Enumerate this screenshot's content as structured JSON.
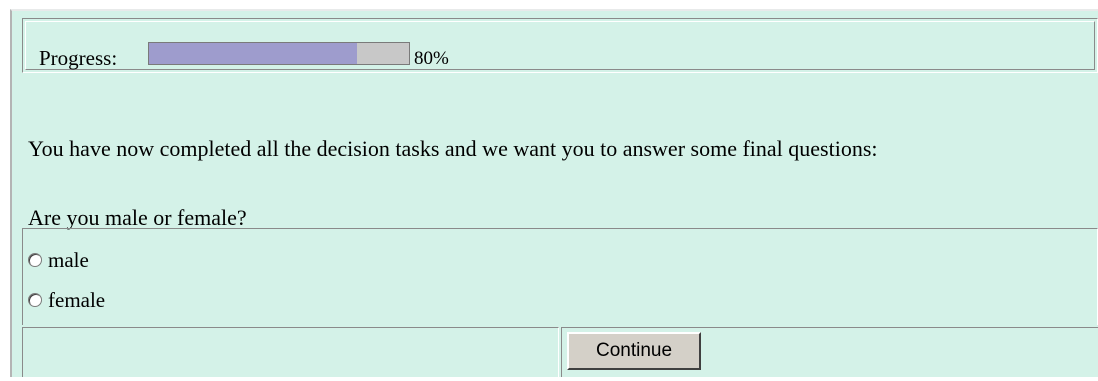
{
  "progress": {
    "label": "Progress:",
    "fraction": 0.8,
    "value_text": "80%",
    "fill_color": "#9e9ccd",
    "track_color": "#c8c8c8"
  },
  "intro_text": "You have now completed all the decision tasks and we want you to answer some final questions:",
  "question": {
    "text": "Are you male or female?",
    "options": [
      {
        "label": "male",
        "selected": false
      },
      {
        "label": "female",
        "selected": false
      }
    ]
  },
  "footer": {
    "continue_label": "Continue"
  },
  "colors": {
    "panel_background": "#d4f2e8",
    "button_face": "#d4d0c8"
  }
}
